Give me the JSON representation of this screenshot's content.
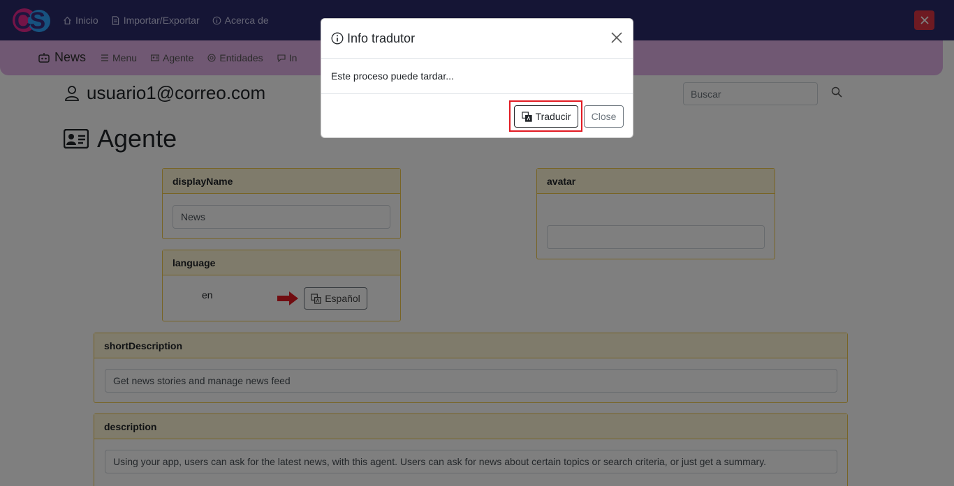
{
  "topnav": {
    "logo_text": "CS",
    "items": [
      {
        "label": "Inicio",
        "icon": "home-icon"
      },
      {
        "label": "Importar/Exportar",
        "icon": "file-icon"
      },
      {
        "label": "Acerca de",
        "icon": "info-icon"
      }
    ]
  },
  "subnav": {
    "brand": "News",
    "items": [
      {
        "label": "Menu",
        "icon": "list-icon"
      },
      {
        "label": "Agente",
        "icon": "id-card-icon"
      },
      {
        "label": "Entidades",
        "icon": "at-icon"
      },
      {
        "label": "In",
        "icon": "chat-icon"
      }
    ]
  },
  "user": {
    "email": "usuario1@correo.com"
  },
  "search": {
    "placeholder": "Buscar"
  },
  "page": {
    "title": "Agente"
  },
  "cards": {
    "displayName": {
      "header": "displayName",
      "value": "News"
    },
    "avatar": {
      "header": "avatar",
      "value": ""
    },
    "language": {
      "header": "language",
      "value": "en",
      "button": "Español"
    },
    "shortDescription": {
      "header": "shortDescription",
      "value": "Get news stories and manage news feed"
    },
    "description": {
      "header": "description",
      "value": "Using your app, users can ask for the latest news, with this agent. Users can ask for news about certain topics or search criteria, or just get a summary."
    }
  },
  "modal": {
    "title": "Info tradutor",
    "body": "Este proceso puede tardar...",
    "translate_button": "Traducir",
    "close_button": "Close"
  },
  "colors": {
    "navbar": "#2b2b6b",
    "subbar": "#e0b0e6",
    "card_border": "#f0c94a",
    "card_header": "#fff6d6",
    "highlight": "#e21a22",
    "danger": "#dc3545"
  }
}
